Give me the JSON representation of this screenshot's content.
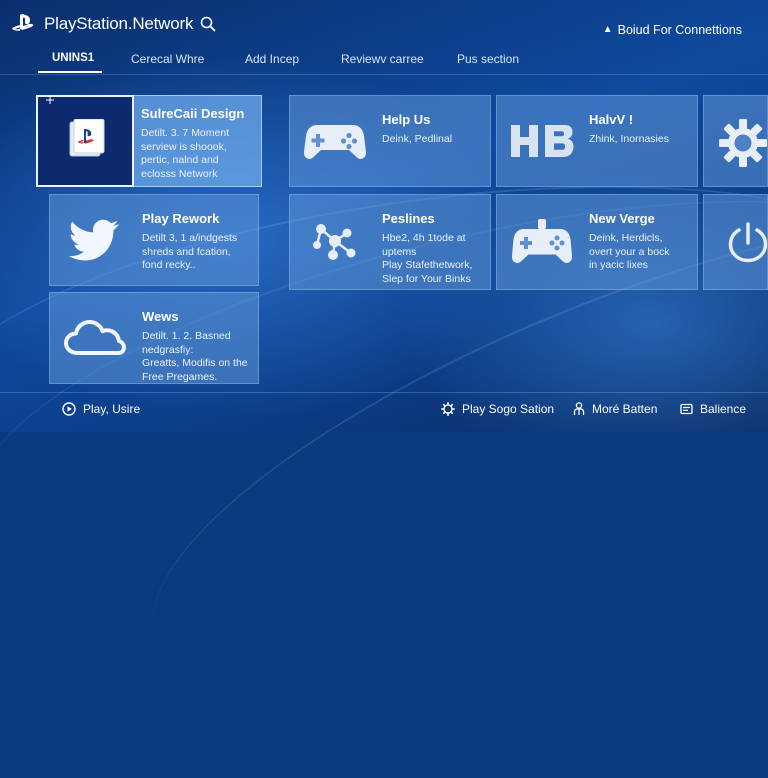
{
  "header": {
    "brand": "PlayStation.Network",
    "connections_label": "Boiud For Connettions"
  },
  "tabs": [
    {
      "label": "UNINS1",
      "active": true
    },
    {
      "label": "Cerecal Whre",
      "active": false
    },
    {
      "label": "Add Incep",
      "active": false
    },
    {
      "label": "Reviewv carree",
      "active": false
    },
    {
      "label": "Pus section",
      "active": false
    }
  ],
  "tiles": {
    "featured": {
      "title": "SulreCaii Design",
      "desc": [
        "Detilt. 3. 7 Moment",
        "serview is shoook,",
        "pertic, nalnd and",
        "eclosss Network"
      ],
      "icon": "playstation-card-icon"
    },
    "play_rework": {
      "title": "Play Rework",
      "desc": [
        "Detilt 3, 1 a/indgests",
        "shreds and fcation,",
        "fond recky.."
      ],
      "icon": "bird-icon"
    },
    "wews": {
      "title": "Wews",
      "desc": [
        "Detilt. 1. 2. Basned",
        "nedgrasfiy:",
        "Greatts, Modifis on the",
        "Free Pregames."
      ],
      "icon": "cloud-icon"
    },
    "help_us": {
      "title": "Help Us",
      "desc": [
        "Deink, Pedlinal"
      ],
      "icon": "gamepad-icon"
    },
    "peslines": {
      "title": "Peslines",
      "desc": [
        "Hbe2, 4h 1tode at",
        "uptems",
        "Play Stafethetwork,",
        "Slep for Your Binks"
      ],
      "icon": "molecule-icon"
    },
    "halw": {
      "title": "HalvV !",
      "desc": [
        "Zhink, Inornasies"
      ],
      "icon": "hb-logo-icon"
    },
    "new_verge": {
      "title": "New Verge",
      "desc": [
        "Deink, Herdicls,",
        "overt your a bock",
        "in yacic lixes"
      ],
      "icon": "controller-icon"
    }
  },
  "footer": {
    "play": "Play, Usire",
    "station": "Play Sogo Sation",
    "more": "Moré Batten",
    "balance": "Balience"
  },
  "colors": {
    "background": "#0f4a9e",
    "tile": "#5f96d7",
    "tile_selected": "#6eaaeb",
    "text": "#ffffff"
  }
}
